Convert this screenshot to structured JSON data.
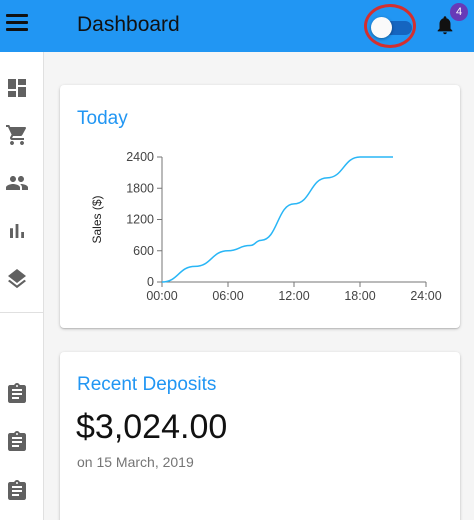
{
  "appbar": {
    "title": "Dashboard",
    "menu_icon": "menu-icon",
    "toggle_state": "on",
    "notifications_icon": "bell-icon",
    "notification_count": "4",
    "color": "#2196f3"
  },
  "drawer": {
    "items": [
      {
        "icon": "dashboard-icon"
      },
      {
        "icon": "shopping-cart-icon"
      },
      {
        "icon": "people-icon"
      },
      {
        "icon": "bar-chart-icon"
      },
      {
        "icon": "layers-icon"
      },
      {
        "icon": "assignment-icon"
      },
      {
        "icon": "assignment-icon"
      },
      {
        "icon": "assignment-icon"
      }
    ]
  },
  "today": {
    "title": "Today"
  },
  "deposits": {
    "title": "Recent Deposits",
    "amount": "$3,024.00",
    "date": "on 15 March, 2019"
  },
  "chart_data": {
    "type": "line",
    "title": "",
    "xlabel": "",
    "ylabel": "Sales ($)",
    "x_ticks": [
      "00:00",
      "06:00",
      "12:00",
      "18:00",
      "24:00"
    ],
    "y_ticks": [
      "0",
      "600",
      "1200",
      "1800",
      "2400"
    ],
    "xlim": [
      0,
      24
    ],
    "ylim": [
      0,
      2400
    ],
    "series": [
      {
        "color": "#29b6f6",
        "x": [
          0,
          3,
          6,
          8,
          9,
          12,
          15,
          18,
          21
        ],
        "y": [
          0,
          300,
          600,
          700,
          800,
          1500,
          2000,
          2400,
          2400
        ]
      }
    ]
  }
}
